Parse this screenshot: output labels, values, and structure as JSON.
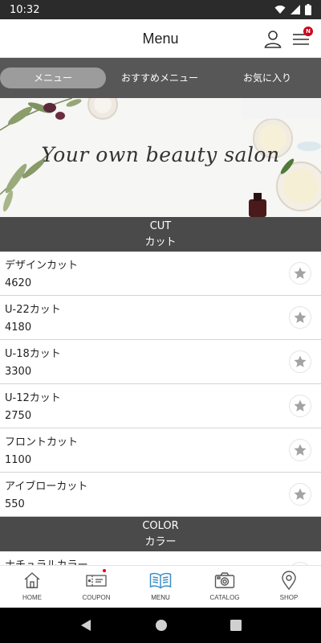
{
  "status_bar": {
    "time": "10:32"
  },
  "app_bar": {
    "title": "Menu",
    "badge": "N"
  },
  "tabs": [
    {
      "label": "メニュー",
      "active": true
    },
    {
      "label": "おすすめメニュー",
      "active": false
    },
    {
      "label": "お気に入り",
      "active": false
    }
  ],
  "banner": {
    "text": "Your own beauty salon"
  },
  "sections": [
    {
      "title_en": "CUT",
      "title_ja": "カット",
      "items": [
        {
          "name": "デザインカット",
          "price": "4620"
        },
        {
          "name": "U-22カット",
          "price": "4180"
        },
        {
          "name": "U-18カット",
          "price": "3300"
        },
        {
          "name": "U-12カット",
          "price": "2750"
        },
        {
          "name": "フロントカット",
          "price": "1100"
        },
        {
          "name": "アイブローカット",
          "price": "550"
        }
      ]
    },
    {
      "title_en": "COLOR",
      "title_ja": "カラー",
      "items": [
        {
          "name": "ナチュラルカラー",
          "price": ""
        }
      ]
    }
  ],
  "bottom_nav": [
    {
      "label": "HOME",
      "icon": "home-icon",
      "active": false
    },
    {
      "label": "COUPON",
      "icon": "coupon-icon",
      "active": false
    },
    {
      "label": "MENU",
      "icon": "menu-book-icon",
      "active": true
    },
    {
      "label": "CATALOG",
      "icon": "camera-icon",
      "active": false
    },
    {
      "label": "SHOP",
      "icon": "map-pin-icon",
      "active": false
    }
  ],
  "colors": {
    "header_bg": "#4a4a4a",
    "tab_bar_bg": "#575757",
    "active_tab_bg": "#9c9c9c",
    "active_nav": "#3a8fc6",
    "badge": "#d0021b"
  }
}
